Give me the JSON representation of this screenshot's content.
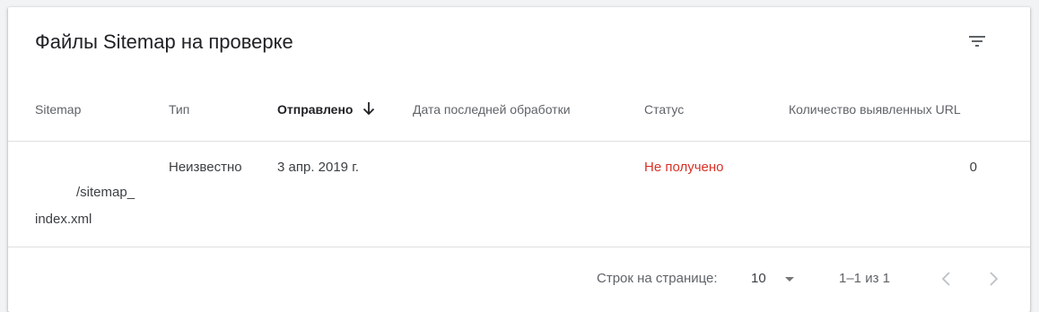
{
  "header": {
    "title": "Файлы Sitemap на проверке",
    "filter_icon": "filter-list-icon"
  },
  "table": {
    "columns": [
      {
        "label": "Sitemap"
      },
      {
        "label": "Тип"
      },
      {
        "label": "Отправлено",
        "sorted": "descending"
      },
      {
        "label": "Дата последней обработки"
      },
      {
        "label": "Статус"
      },
      {
        "label": "Количество выявленных URL"
      }
    ],
    "rows": [
      {
        "sitemap_line1": "/sitemap_",
        "sitemap_line2": "index.xml",
        "type": "Неизвестно",
        "submitted": "3 апр. 2019 г.",
        "last_processed": "",
        "status": "Не получено",
        "url_count": "0"
      }
    ]
  },
  "footer": {
    "rows_per_page_label": "Строк на странице:",
    "rows_per_page_value": "10",
    "range_text": "1–1 из 1",
    "prev_icon": "chevron-left-icon",
    "next_icon": "chevron-right-icon"
  },
  "colors": {
    "status_error": "#d93025",
    "header_text": "#5f6368",
    "divider": "#e0e0e0"
  }
}
